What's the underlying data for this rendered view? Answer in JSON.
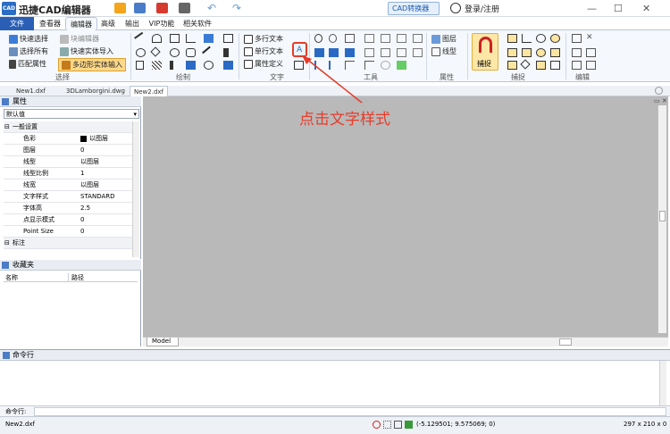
{
  "app": {
    "title": "迅捷CAD编辑器",
    "logo_text": "CAD"
  },
  "titlebar": {
    "convert_label": "CAD转换器",
    "login_label": "登录/注册"
  },
  "tabs": [
    {
      "label": "文件"
    },
    {
      "label": "查看器"
    },
    {
      "label": "编辑器"
    },
    {
      "label": "高级"
    },
    {
      "label": "输出"
    },
    {
      "label": "VIP功能"
    },
    {
      "label": "相关软件"
    }
  ],
  "ribbon": {
    "select": {
      "label": "选择",
      "b1": "快速选择",
      "b2": "选择所有",
      "b3": "匹配属性",
      "b4": "块编辑器",
      "b5": "快速实体导入",
      "b6": "多边形实体输入"
    },
    "draw": {
      "label": "绘制"
    },
    "text": {
      "label": "文字",
      "b1": "多行文本",
      "b2": "单行文本",
      "b3": "属性定义"
    },
    "tools": {
      "label": "工具"
    },
    "props": {
      "label": "属性",
      "b1": "图层",
      "b2": "线型"
    },
    "snap": {
      "label": "捕捉",
      "b1": "捕捉"
    },
    "edit": {
      "label": "编辑"
    }
  },
  "doc_tabs": [
    "New1.dxf",
    "3DLamborgini.dwg",
    "New2.dxf"
  ],
  "props_panel": {
    "title": "属性",
    "dropdown": "默认值",
    "rows": [
      {
        "k": "一般设置",
        "v": ""
      },
      {
        "k": "色彩",
        "v": "以图层"
      },
      {
        "k": "图层",
        "v": "0"
      },
      {
        "k": "线型",
        "v": "以图层"
      },
      {
        "k": "线型比例",
        "v": "1"
      },
      {
        "k": "线宽",
        "v": "以图层"
      },
      {
        "k": "文字样式",
        "v": "STANDARD"
      },
      {
        "k": "字体高",
        "v": "2.5"
      },
      {
        "k": "点显示模式",
        "v": "0"
      },
      {
        "k": "Point Size",
        "v": "0"
      },
      {
        "k": "标注",
        "v": ""
      }
    ]
  },
  "fav_panel": {
    "title": "收藏夹",
    "col1": "名称",
    "col2": "路径"
  },
  "canvas": {
    "model_tab": "Model"
  },
  "command": {
    "title": "命令行",
    "prompt": "命令行:"
  },
  "status": {
    "file": "New2.dxf",
    "coords": "(-5.129501; 9.575069; 0)",
    "size": "297 x 210 x 0"
  },
  "annotation": {
    "callout": "点击文字样式"
  },
  "colors": {
    "accent": "#2a5fb5",
    "annotation": "#e53c2a",
    "canvas": "#b9b9b9"
  }
}
